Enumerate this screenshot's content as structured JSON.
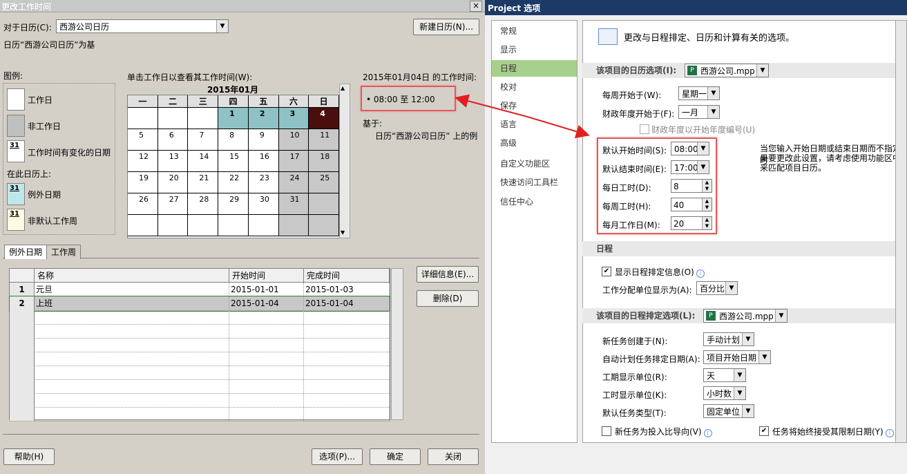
{
  "left": {
    "title": "更改工作时间",
    "close": "×",
    "for_calendar_label": "对于日历(C):",
    "calendar_value": "西游公司日历",
    "new_calendar": "新建日历(N)...",
    "based_on": "日历“西游公司日历”为基",
    "legend_title": "图例:",
    "legend": [
      {
        "label": "工作日",
        "num": ""
      },
      {
        "label": "非工作日",
        "num": ""
      },
      {
        "label": "工作时间有变化的日期",
        "num": "31"
      }
    ],
    "on_this_calendar": "在此日历上:",
    "legend2": [
      {
        "label": "例外日期",
        "num": "31"
      },
      {
        "label": "非默认工作周",
        "num": "31"
      }
    ],
    "click_hint": "单击工作日以查看其工作时间(W):",
    "month_title": "2015年01月",
    "weekdays": [
      "一",
      "二",
      "三",
      "四",
      "五",
      "六",
      "日"
    ],
    "weeks": [
      [
        "",
        "",
        "",
        "1",
        "2",
        "3",
        "4"
      ],
      [
        "5",
        "6",
        "7",
        "8",
        "9",
        "10",
        "11"
      ],
      [
        "12",
        "13",
        "14",
        "15",
        "16",
        "17",
        "18"
      ],
      [
        "19",
        "20",
        "21",
        "22",
        "23",
        "24",
        "25"
      ],
      [
        "26",
        "27",
        "28",
        "29",
        "30",
        "31",
        ""
      ],
      [
        "",
        "",
        "",
        "",
        "",
        "",
        ""
      ]
    ],
    "work_time_title": "2015年01月04日 的工作时间:",
    "work_time": "• 08:00 至 12:00",
    "based_label": "基于:",
    "based_text": "日历“西游公司日历” 上的例",
    "tabs": [
      "例外日期",
      "工作周"
    ],
    "table_headers": [
      "名称",
      "开始时间",
      "完成时间"
    ],
    "rows": [
      {
        "num": "1",
        "name": "元旦",
        "start": "2015-01-01",
        "end": "2015-01-03"
      },
      {
        "num": "2",
        "name": "上班",
        "start": "2015-01-04",
        "end": "2015-01-04"
      }
    ],
    "detail_btn": "详细信息(E)...",
    "delete_btn": "删除(D)",
    "help_btn": "帮助(H)",
    "options_btn": "选项(P)...",
    "ok_btn": "确定",
    "close_btn": "关闭"
  },
  "right": {
    "title": "Project 选项",
    "nav": [
      "常规",
      "显示",
      "日程",
      "校对",
      "保存",
      "语言",
      "高级",
      "自定义功能区",
      "快速访问工具栏",
      "信任中心"
    ],
    "header_text": "更改与日程排定、日历和计算有关的选项。",
    "cal_options_label": "该项目的日历选项(I):",
    "project_file": "西游公司.mpp",
    "week_start_label": "每周开始于(W):",
    "week_start_value": "星期一",
    "fiscal_start_label": "财政年度开始于(F):",
    "fiscal_start_value": "一月",
    "fiscal_numbering": "财政年度以开始年度编号(U)",
    "default_start_label": "默认开始时间(S):",
    "default_start_value": "08:00",
    "default_end_label": "默认结束时间(E):",
    "default_end_value": "17:00",
    "hours_day_label": "每日工时(D):",
    "hours_day_value": "8",
    "hours_week_label": "每周工时(H):",
    "hours_week_value": "40",
    "days_month_label": "每月工作日(M):",
    "days_month_value": "20",
    "hint_lines": [
      "当您输入开始日期或结束日期而不指定时",
      "果要更改此设置，请考虑使用功能区中“",
      "来匹配项目日历。"
    ],
    "schedule_section": "日程",
    "show_schedule_info": "显示日程排定信息(O)",
    "assignment_unit_label": "工作分配单位显示为(A):",
    "assignment_unit_value": "百分比",
    "sched_options_label": "该项目的日程排定选项(L):",
    "new_task_label": "新任务创建于(N):",
    "new_task_value": "手动计划",
    "auto_sched_label": "自动计划任务排定日期(A):",
    "auto_sched_value": "项目开始日期",
    "duration_unit_label": "工期显示单位(R):",
    "duration_unit_value": "天",
    "work_unit_label": "工时显示单位(K):",
    "work_unit_value": "小时数",
    "task_type_label": "默认任务类型(T):",
    "task_type_value": "固定单位",
    "effort_driven": "新任务为投入比导向(V)",
    "honor_constraints": "任务将始终接受其限制日期(Y)"
  },
  "colors": {
    "accent": "#e05a5a",
    "nav_selected": "#a8d08d",
    "title_bar": "#1c3a66"
  }
}
